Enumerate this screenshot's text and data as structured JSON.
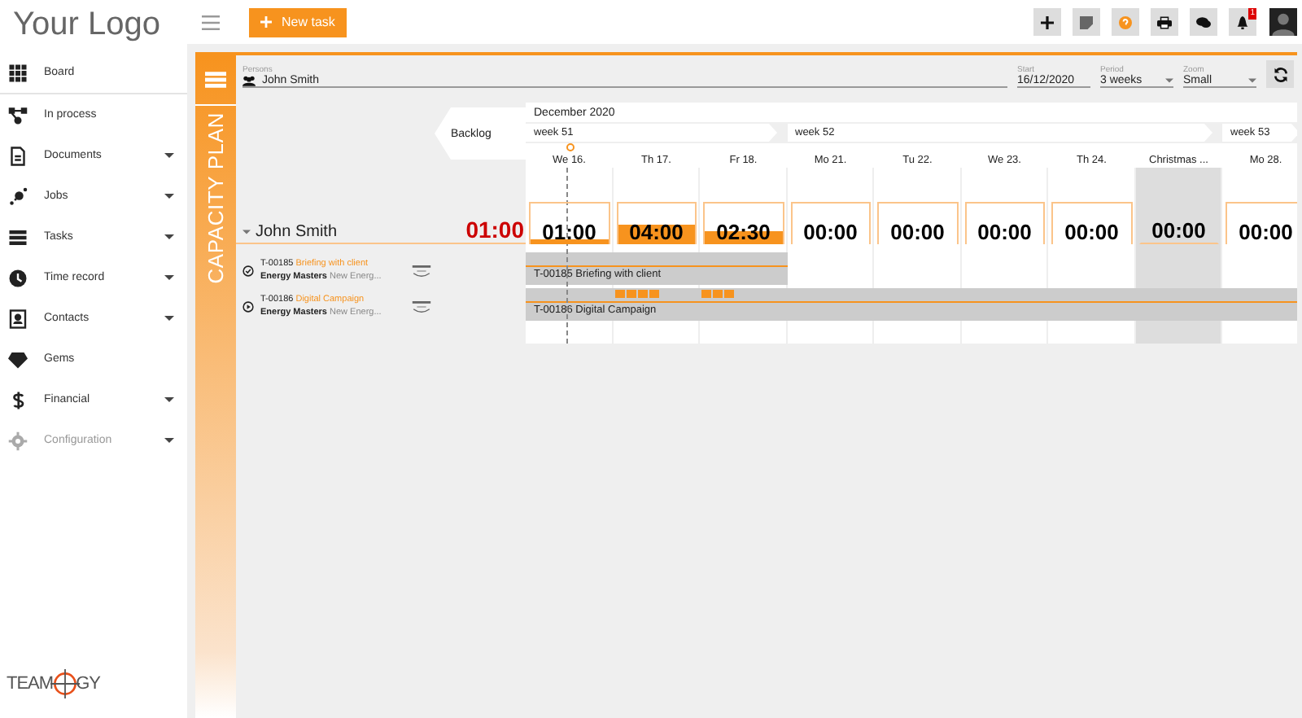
{
  "logo": "Your Logo",
  "sidebar": {
    "items": [
      {
        "label": "Board",
        "expandable": false,
        "disabled": false
      },
      {
        "label": "In process",
        "expandable": false,
        "disabled": false
      },
      {
        "label": "Documents",
        "expandable": true,
        "disabled": false
      },
      {
        "label": "Jobs",
        "expandable": true,
        "disabled": false
      },
      {
        "label": "Tasks",
        "expandable": true,
        "disabled": false
      },
      {
        "label": "Time record",
        "expandable": true,
        "disabled": false
      },
      {
        "label": "Contacts",
        "expandable": true,
        "disabled": false
      },
      {
        "label": "Gems",
        "expandable": false,
        "disabled": false
      },
      {
        "label": "Financial",
        "expandable": true,
        "disabled": false
      },
      {
        "label": "Configuration",
        "expandable": true,
        "disabled": true
      }
    ],
    "brand": {
      "left": "TEAM",
      "right": "GY"
    }
  },
  "topbar": {
    "new_task": "New task",
    "notifications": "1"
  },
  "panel": {
    "title": "CAPACITY PLAN",
    "filters": {
      "persons": {
        "label": "Persons",
        "value": "John Smith"
      },
      "start": {
        "label": "Start",
        "value": "16/12/2020"
      },
      "period": {
        "label": "Period",
        "value": "3 weeks"
      },
      "zoom": {
        "label": "Zoom",
        "value": "Small"
      }
    },
    "backlog": "Backlog",
    "month": "December 2020",
    "weeks": [
      {
        "label": "week 51",
        "days": [
          {
            "label": "We 16.",
            "hours": "01:00",
            "holiday": false,
            "today": true
          },
          {
            "label": "Th 17.",
            "hours": "04:00",
            "holiday": false,
            "today": false
          },
          {
            "label": "Fr 18.",
            "hours": "02:30",
            "holiday": false,
            "today": false
          }
        ]
      },
      {
        "label": "week 52",
        "days": [
          {
            "label": "Mo 21.",
            "hours": "00:00",
            "holiday": false,
            "today": false
          },
          {
            "label": "Tu 22.",
            "hours": "00:00",
            "holiday": false,
            "today": false
          },
          {
            "label": "We 23.",
            "hours": "00:00",
            "holiday": false,
            "today": false
          },
          {
            "label": "Th 24.",
            "hours": "00:00",
            "holiday": false,
            "today": false
          },
          {
            "label": "Christmas ...",
            "hours": "00:00",
            "holiday": true,
            "today": false
          }
        ]
      },
      {
        "label": "week 53",
        "days": [
          {
            "label": "Mo 28.",
            "hours": "00:00",
            "holiday": false,
            "today": false
          }
        ]
      }
    ],
    "person": {
      "name": "John Smith",
      "expanded": true,
      "total": "01:00"
    },
    "tasks": [
      {
        "id": "T-00185",
        "title": "Briefing with client",
        "client": "Energy Masters",
        "project": "New Energ...",
        "kind": "done",
        "bar_label": "T-00185 Briefing with client",
        "days": [
          {
            "bar": true
          },
          {
            "bar": true
          },
          {
            "bar": true
          },
          {
            "bar": false
          },
          {
            "bar": false
          },
          {
            "bar": false
          },
          {
            "bar": false
          },
          {
            "bar": false
          },
          {
            "bar": false
          }
        ]
      },
      {
        "id": "T-00186",
        "title": "Digital Campaign",
        "client": "Energy Masters",
        "project": "New Energ...",
        "kind": "running",
        "bar_label": "T-00186 Digital Campaign",
        "days": [
          {
            "bar": true
          },
          {
            "bar": true,
            "blocks": [
              true,
              true,
              true,
              true
            ]
          },
          {
            "bar": true,
            "blocks": [
              true,
              true,
              true
            ]
          },
          {
            "bar": true
          },
          {
            "bar": true
          },
          {
            "bar": true
          },
          {
            "bar": true
          },
          {
            "bar": true
          },
          {
            "bar": true
          }
        ]
      }
    ]
  }
}
